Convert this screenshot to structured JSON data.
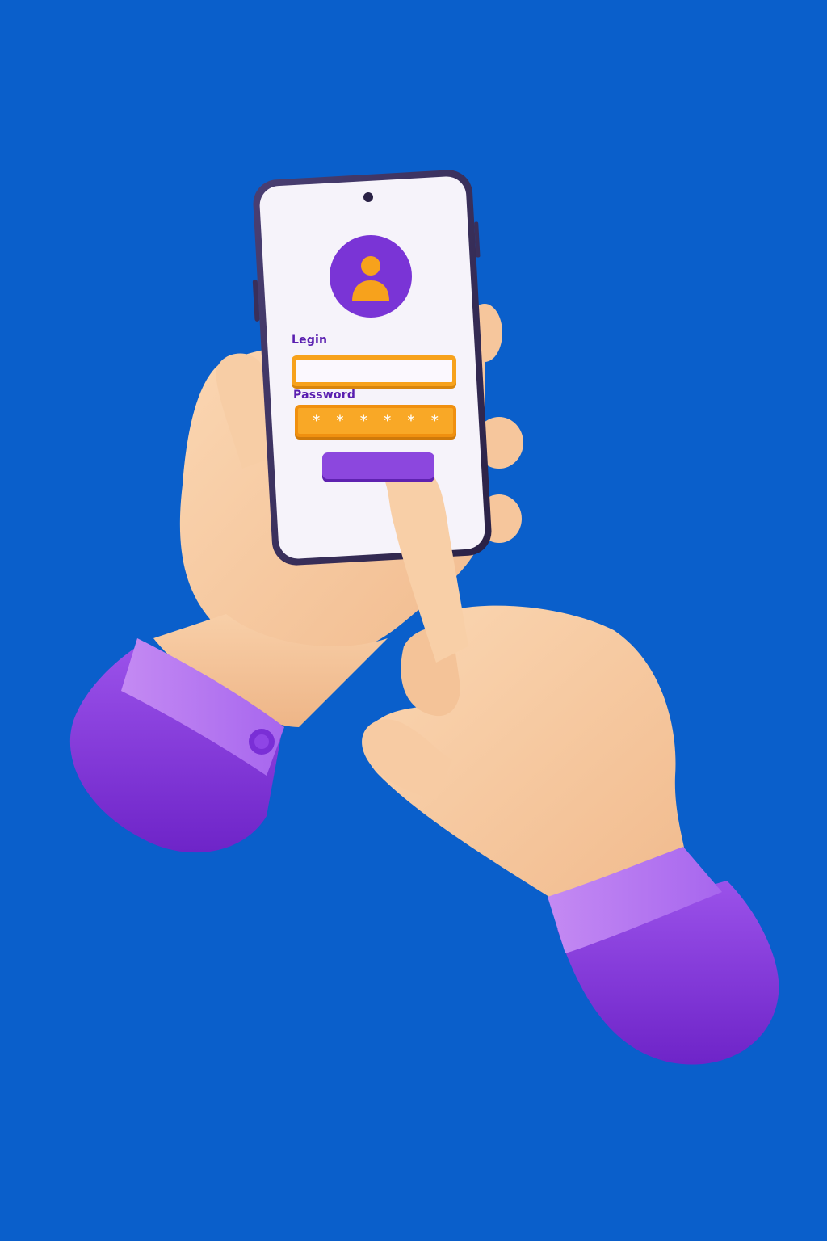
{
  "login_screen": {
    "login_label": "Legin",
    "password_label": "Password",
    "password_mask": [
      "*",
      "*",
      "*",
      "*",
      "*",
      "*"
    ],
    "submit_label": ""
  },
  "colors": {
    "background": "#0a5fcb",
    "phone_frame": "#3a2f5a",
    "screen": "#f6f3fa",
    "accent_purple": "#8c47de",
    "accent_orange": "#f7a21c",
    "skin": "#f6c9a0",
    "sleeve": "#8a3fe0"
  },
  "icons": {
    "avatar": "user-icon",
    "camera": "front-camera-icon"
  }
}
